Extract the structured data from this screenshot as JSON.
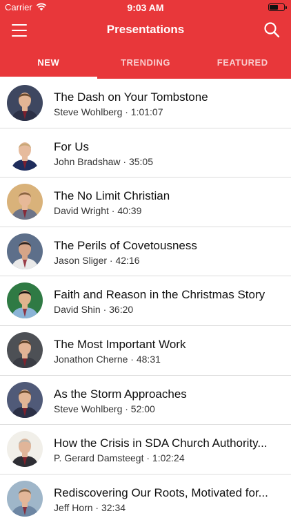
{
  "status_bar": {
    "carrier": "Carrier",
    "time": "9:03 AM"
  },
  "header": {
    "title": "Presentations"
  },
  "tabs": [
    {
      "label": "NEW",
      "active": true
    },
    {
      "label": "TRENDING",
      "active": false
    },
    {
      "label": "FEATURED",
      "active": false
    }
  ],
  "icons": {
    "menu": "hamburger-menu-icon",
    "search": "search-icon",
    "wifi": "wifi-icon",
    "battery": "battery-icon"
  },
  "colors": {
    "accent": "#e8373a",
    "divider": "#dcdcdc"
  },
  "presentations": [
    {
      "title": "The Dash on Your Tombstone",
      "speaker": "Steve Wohlberg",
      "duration": "1:01:07",
      "subtitle": "Steve Wohlberg · 1:01:07",
      "avatar_bg": "#3e4760",
      "skin": "#e2b595",
      "hair": "#6b4a2e",
      "shirt": "#2b3046"
    },
    {
      "title": "For Us",
      "speaker": "John Bradshaw",
      "duration": "35:05",
      "subtitle": "John Bradshaw · 35:05",
      "avatar_bg": "#ffffff",
      "skin": "#e6bb9d",
      "hair": "#c9a777",
      "shirt": "#1f2d5c"
    },
    {
      "title": "The No Limit Christian",
      "speaker": "David Wright",
      "duration": "40:39",
      "subtitle": "David Wright · 40:39",
      "avatar_bg": "#d9b27a",
      "skin": "#e7b998",
      "hair": "#8a6440",
      "shirt": "#6d7488"
    },
    {
      "title": "The Perils of Covetousness",
      "speaker": "Jason Sliger",
      "duration": "42:16",
      "subtitle": "Jason Sliger · 42:16",
      "avatar_bg": "#5d6f8a",
      "skin": "#d6a588",
      "hair": "#2c2420",
      "shirt": "#e9e9e9"
    },
    {
      "title": "Faith and Reason in the Christmas Story",
      "speaker": "David Shin",
      "duration": "36:20",
      "subtitle": "David Shin · 36:20",
      "avatar_bg": "#2f7a44",
      "skin": "#e0b48e",
      "hair": "#1a1614",
      "shirt": "#8ab3d6"
    },
    {
      "title": "The Most Important Work",
      "speaker": "Jonathon Cherne",
      "duration": "48:31",
      "subtitle": "Jonathon Cherne · 48:31",
      "avatar_bg": "#4d5055",
      "skin": "#e2b395",
      "hair": "#5a3f28",
      "shirt": "#3a3c44"
    },
    {
      "title": "As the Storm Approaches",
      "speaker": "Steve Wohlberg",
      "duration": "52:00",
      "subtitle": "Steve Wohlberg · 52:00",
      "avatar_bg": "#505a78",
      "skin": "#e2b595",
      "hair": "#6b4a2e",
      "shirt": "#2b3046"
    },
    {
      "title": "How the Crisis in SDA Church Authority...",
      "speaker": "P. Gerard Damsteegt",
      "duration": "1:02:24",
      "subtitle": "P. Gerard Damsteegt · 1:02:24",
      "avatar_bg": "#f1efe9",
      "skin": "#e0b599",
      "hair": "#bcb6ac",
      "shirt": "#2e2e34"
    },
    {
      "title": "Rediscovering Our Roots, Motivated for...",
      "speaker": "Jeff Horn",
      "duration": "32:34",
      "subtitle": "Jeff Horn · 32:34",
      "avatar_bg": "#9fb6c9",
      "skin": "#e3b698",
      "hair": "#7e6247",
      "shirt": "#6d86a3"
    }
  ]
}
